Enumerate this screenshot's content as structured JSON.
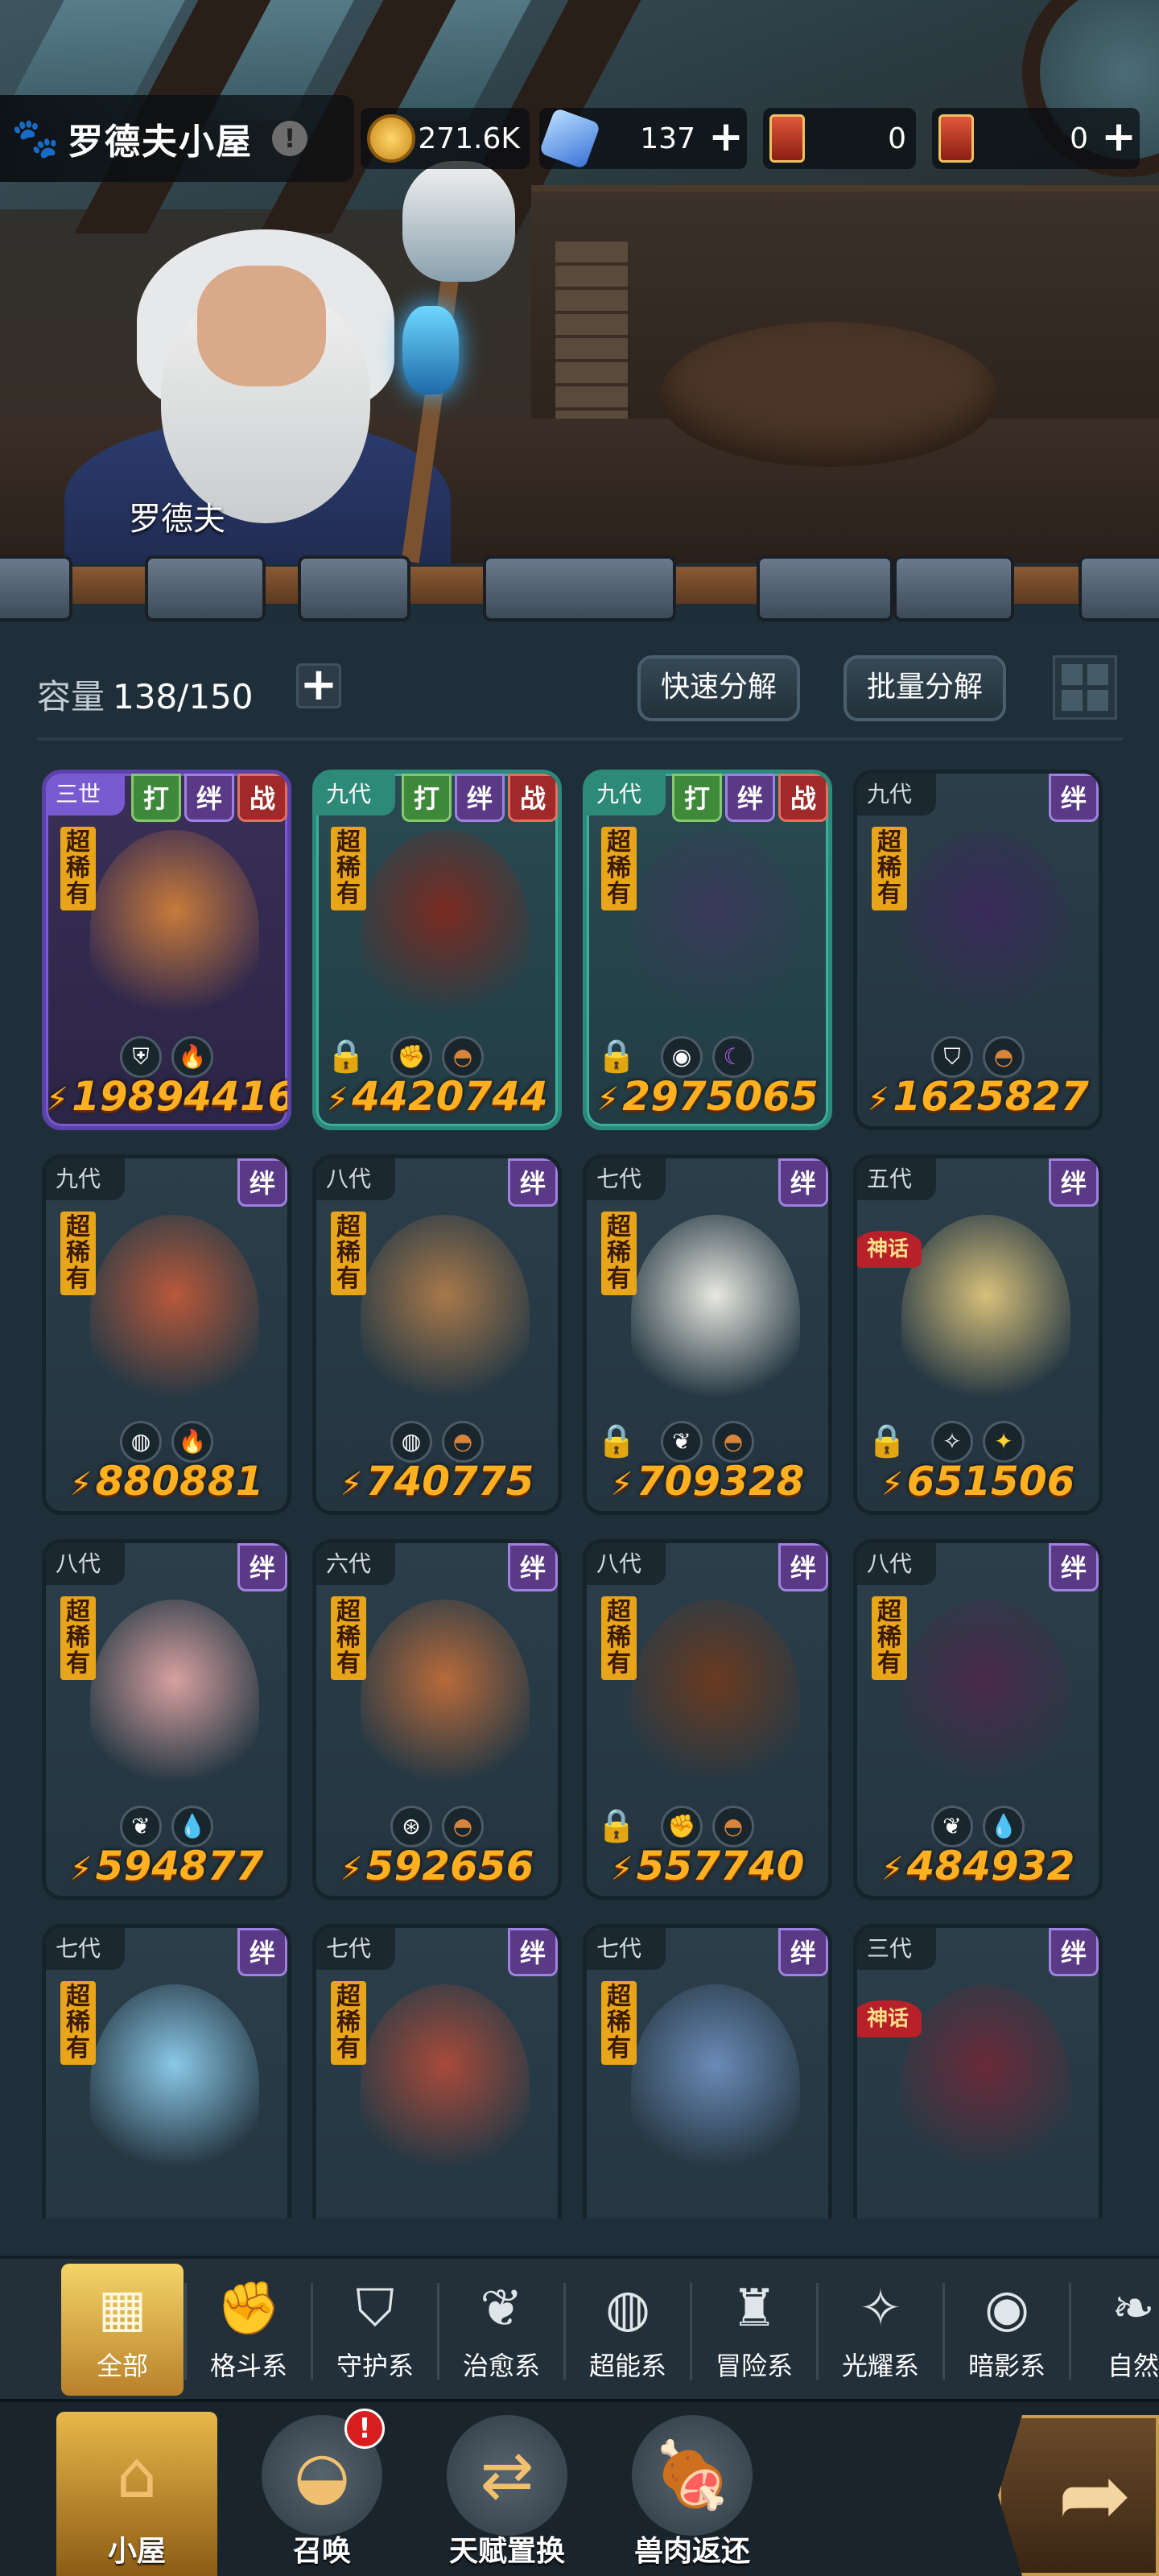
{
  "header": {
    "location_title": "罗德夫小屋",
    "paw_icon": "paw-icon",
    "info_icon": "info-icon",
    "npc_name": "罗德夫"
  },
  "resources": {
    "gold": {
      "icon": "gold-coin-icon",
      "value": "271.6K"
    },
    "gems": {
      "icon": "crystal-icon",
      "value": "137"
    },
    "card_a": {
      "icon": "summon-ticket-icon",
      "value": "0"
    },
    "card_b": {
      "icon": "scroll-ticket-icon",
      "value": "0"
    }
  },
  "storage": {
    "capacity_label": "容量",
    "capacity_value": "138/150",
    "quick_dismantle": "快速分解",
    "batch_dismantle": "批量分解"
  },
  "cards": [
    {
      "gen": "三世",
      "tags": [
        "打",
        "绊",
        "战"
      ],
      "rarity": "超稀有",
      "locked": false,
      "attrs": [
        "guardian",
        "fire"
      ],
      "power": "19894416",
      "frame": "purple"
    },
    {
      "gen": "九代",
      "tags": [
        "打",
        "绊",
        "战"
      ],
      "rarity": "超稀有",
      "locked": true,
      "attrs": [
        "fist",
        "earth"
      ],
      "power": "4420744",
      "frame": "teal"
    },
    {
      "gen": "九代",
      "tags": [
        "打",
        "绊",
        "战"
      ],
      "rarity": "超稀有",
      "locked": true,
      "attrs": [
        "shadow",
        "dark"
      ],
      "power": "2975065",
      "frame": "teal"
    },
    {
      "gen": "九代",
      "tags": [
        "绊"
      ],
      "rarity": "超稀有",
      "locked": false,
      "attrs": [
        "shield",
        "earth"
      ],
      "power": "1625827",
      "frame": "plain"
    },
    {
      "gen": "九代",
      "tags": [
        "绊"
      ],
      "rarity": "超稀有",
      "locked": false,
      "attrs": [
        "psychic",
        "fire"
      ],
      "power": "880881",
      "frame": "plain"
    },
    {
      "gen": "八代",
      "tags": [
        "绊"
      ],
      "rarity": "超稀有",
      "locked": false,
      "attrs": [
        "psychic",
        "earth"
      ],
      "power": "740775",
      "frame": "plain"
    },
    {
      "gen": "七代",
      "tags": [
        "绊"
      ],
      "rarity": "超稀有",
      "locked": true,
      "attrs": [
        "leaf",
        "earth"
      ],
      "power": "709328",
      "frame": "plain"
    },
    {
      "gen": "五代",
      "tags": [
        "绊"
      ],
      "rarity": "神话",
      "locked": true,
      "attrs": [
        "light",
        "star"
      ],
      "power": "651506",
      "frame": "plain"
    },
    {
      "gen": "八代",
      "tags": [
        "绊"
      ],
      "rarity": "超稀有",
      "locked": false,
      "attrs": [
        "leaf",
        "water"
      ],
      "power": "594877",
      "frame": "plain"
    },
    {
      "gen": "六代",
      "tags": [
        "绊"
      ],
      "rarity": "超稀有",
      "locked": false,
      "attrs": [
        "guard",
        "earth"
      ],
      "power": "592656",
      "frame": "plain"
    },
    {
      "gen": "八代",
      "tags": [
        "绊"
      ],
      "rarity": "超稀有",
      "locked": true,
      "attrs": [
        "fist",
        "earth"
      ],
      "power": "557740",
      "frame": "plain"
    },
    {
      "gen": "八代",
      "tags": [
        "绊"
      ],
      "rarity": "超稀有",
      "locked": false,
      "attrs": [
        "leaf",
        "water"
      ],
      "power": "484932",
      "frame": "plain"
    },
    {
      "gen": "七代",
      "tags": [
        "绊"
      ],
      "rarity": "超稀有",
      "locked": false,
      "attrs": [],
      "power": "",
      "frame": "plain"
    },
    {
      "gen": "七代",
      "tags": [
        "绊"
      ],
      "rarity": "超稀有",
      "locked": false,
      "attrs": [],
      "power": "",
      "frame": "plain"
    },
    {
      "gen": "七代",
      "tags": [
        "绊"
      ],
      "rarity": "超稀有",
      "locked": false,
      "attrs": [],
      "power": "",
      "frame": "plain"
    },
    {
      "gen": "三代",
      "tags": [
        "绊"
      ],
      "rarity": "神话",
      "locked": false,
      "attrs": [],
      "power": "",
      "frame": "plain"
    }
  ],
  "filters": [
    {
      "label": "全部",
      "icon": "all-icon",
      "active": true
    },
    {
      "label": "格斗系",
      "icon": "fist-icon"
    },
    {
      "label": "守护系",
      "icon": "shield-icon"
    },
    {
      "label": "治愈系",
      "icon": "sprout-icon"
    },
    {
      "label": "超能系",
      "icon": "psychic-icon"
    },
    {
      "label": "冒险系",
      "icon": "lantern-icon"
    },
    {
      "label": "光耀系",
      "icon": "light-icon"
    },
    {
      "label": "暗影系",
      "icon": "shadow-icon"
    },
    {
      "label": "自然",
      "icon": "leaf-icon"
    }
  ],
  "nav": [
    {
      "label": "小屋",
      "icon": "house-icon",
      "active": true
    },
    {
      "label": "召唤",
      "icon": "egg-icon",
      "badge": "!"
    },
    {
      "label": "天赋置换",
      "icon": "swap-icon"
    },
    {
      "label": "兽肉返还",
      "icon": "meat-icon"
    }
  ],
  "misc": {
    "arrow_icon": "arrow-icon",
    "mythic_label": "神话",
    "power_icon": "power-icon"
  }
}
